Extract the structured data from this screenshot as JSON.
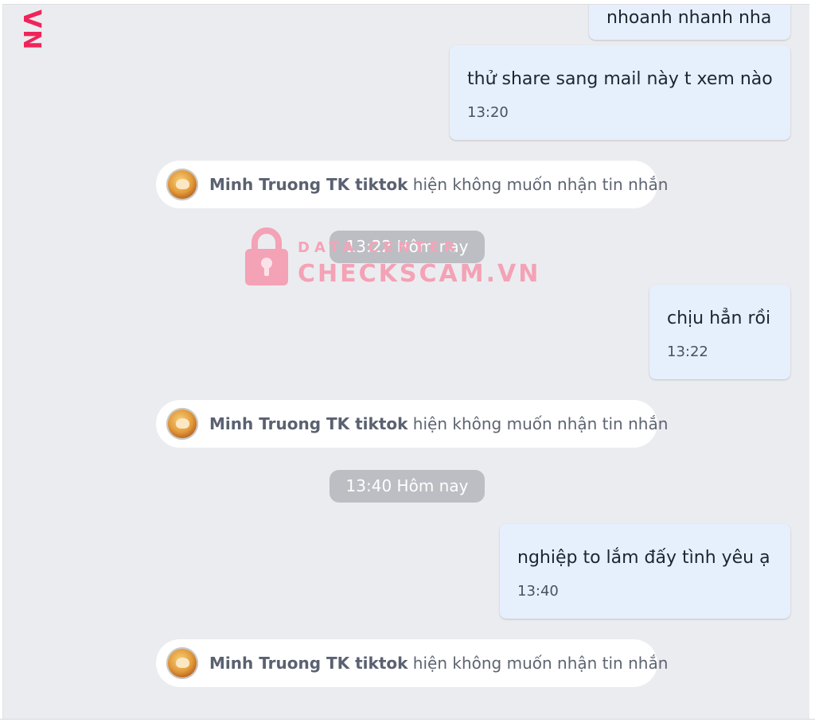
{
  "brand": {
    "side_logo_text": "VN",
    "watermark_top": "DATA CENTER",
    "watermark_main": "CHECKSCAM.VN",
    "accent_color": "#f0245a"
  },
  "messages": [
    {
      "text": "nhoanh nhanh nha",
      "time": ""
    },
    {
      "text": "thử share sang mail này t xem nào",
      "time": "13:20"
    },
    {
      "text": "chịu hẳn rồi",
      "time": "13:22"
    },
    {
      "text": "nghiệp to lắm đấy tình yêu ạ",
      "time": "13:40"
    }
  ],
  "system_notices": [
    {
      "name": "Minh Truong TK tiktok",
      "text": " hiện không muốn nhận tin nhắn"
    },
    {
      "name": "Minh Truong TK tiktok",
      "text": " hiện không muốn nhận tin nhắn"
    },
    {
      "name": "Minh Truong TK tiktok",
      "text": " hiện không muốn nhận tin nhắn"
    }
  ],
  "time_separators": [
    {
      "label": "13:22 Hôm nay"
    },
    {
      "label": "13:40 Hôm nay"
    }
  ],
  "colors": {
    "chat_background": "#ebecf0",
    "sent_bubble": "#e6f0fd",
    "time_pill": "#bdbec3"
  }
}
